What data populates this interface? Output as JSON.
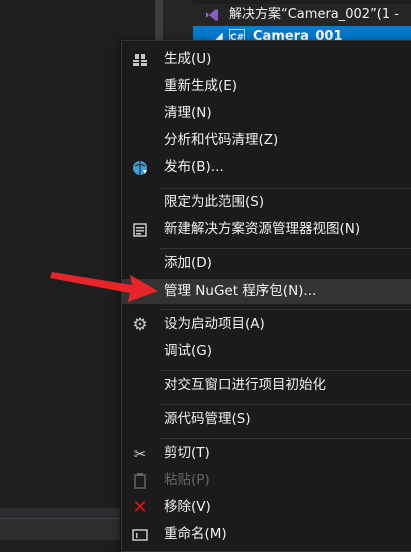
{
  "solution_explorer": {
    "solution_label": "解决方案“Camera_002”(1 -",
    "project_label": "Camera_001",
    "project_icon_text": "C#"
  },
  "context_menu": {
    "items": [
      {
        "label": "生成(U)",
        "icon": "build-icon"
      },
      {
        "label": "重新生成(E)",
        "icon": ""
      },
      {
        "label": "清理(N)",
        "icon": ""
      },
      {
        "label": "分析和代码清理(Z)",
        "icon": ""
      },
      {
        "label": "发布(B)...",
        "icon": "publish-globe-icon"
      },
      {
        "label": "限定为此范围(S)",
        "icon": ""
      },
      {
        "label": "新建解决方案资源管理器视图(N)",
        "icon": "new-view-icon"
      },
      {
        "label": "添加(D)",
        "icon": ""
      },
      {
        "label": "管理 NuGet 程序包(N)...",
        "icon": ""
      },
      {
        "label": "设为启动项目(A)",
        "icon": "gear-icon"
      },
      {
        "label": "调试(G)",
        "icon": ""
      },
      {
        "label": "对交互窗口进行项目初始化",
        "icon": ""
      },
      {
        "label": "源代码管理(S)",
        "icon": ""
      },
      {
        "label": "剪切(T)",
        "icon": "scissors-icon"
      },
      {
        "label": "粘贴(P)",
        "icon": "paste-icon",
        "disabled": true
      },
      {
        "label": "移除(V)",
        "icon": "remove-x-icon"
      },
      {
        "label": "重命名(M)",
        "icon": "rename-icon"
      }
    ]
  },
  "colors": {
    "accent": "#007acc",
    "arrow": "#e8242b",
    "remove_icon": "#e51400",
    "globe_icon": "#3c9cd7"
  }
}
